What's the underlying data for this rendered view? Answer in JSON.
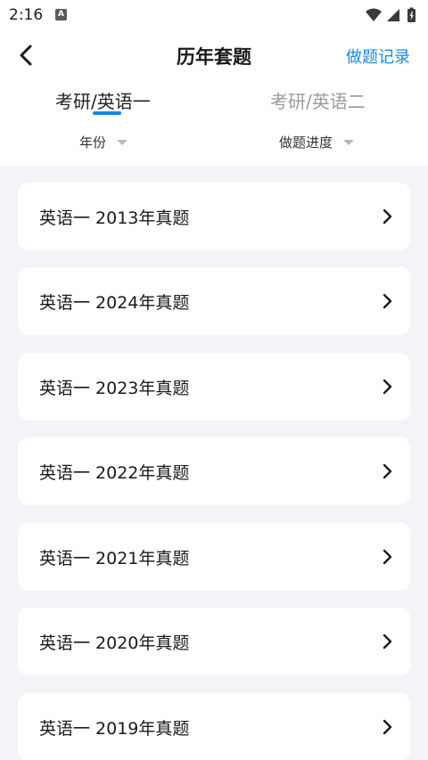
{
  "status": {
    "time": "2:16",
    "a_icon": "A"
  },
  "nav": {
    "title": "历年套题",
    "action": "做题记录"
  },
  "tabs": [
    {
      "label": "考研/英语一"
    },
    {
      "label": "考研/英语二"
    }
  ],
  "filters": [
    {
      "label": "年份"
    },
    {
      "label": "做题进度"
    }
  ],
  "items": [
    {
      "label": "英语一 2013年真题"
    },
    {
      "label": "英语一 2024年真题"
    },
    {
      "label": "英语一 2023年真题"
    },
    {
      "label": "英语一 2022年真题"
    },
    {
      "label": "英语一 2021年真题"
    },
    {
      "label": "英语一 2020年真题"
    },
    {
      "label": "英语一 2019年真题"
    }
  ],
  "colors": {
    "accent": "#1a88e0",
    "list_bg": "#f3f4f7",
    "inactive_tab": "#9a9a9a"
  }
}
